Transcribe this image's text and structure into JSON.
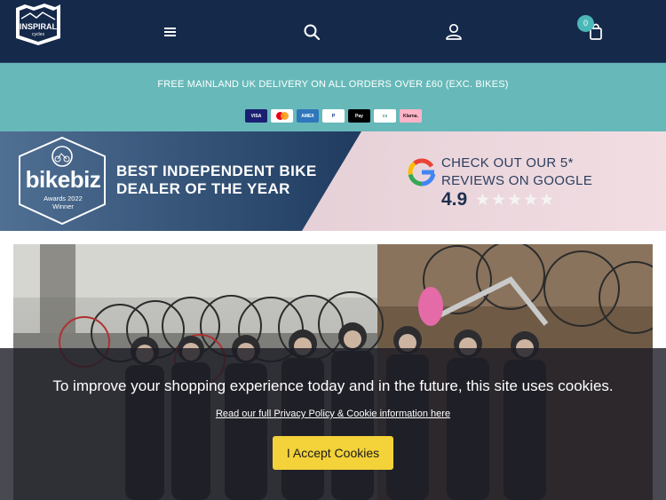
{
  "header": {
    "logo_text": "INSPIRAL cycles",
    "cart_count": "0",
    "icons": [
      "hamburger-menu-icon",
      "search-icon",
      "user-account-icon",
      "shopping-bag-icon"
    ],
    "background_color": "#15294a"
  },
  "delivery_banner": {
    "text": "FREE MAINLAND UK DELIVERY ON ALL ORDERS OVER £60 (EXC. BIKES)",
    "background_color": "#67b9b9",
    "payment_methods": [
      "VISA",
      "Mastercard",
      "American Express",
      "PayPal",
      "Apple Pay",
      "Cycle Scheme",
      "Klarna."
    ]
  },
  "awards_banner": {
    "bikebiz_name": "bikebiz",
    "bikebiz_sub_line1": "Awards 2022",
    "bikebiz_sub_line2": "Winner",
    "title_line1": "BEST INDEPENDENT BIKE",
    "title_line2": "DEALER OF THE YEAR",
    "google_line1": "CHECK OUT OUR 5*",
    "google_line2": "REVIEWS ON GOOGLE",
    "rating": "4.9",
    "stars_filled": 5
  },
  "cookie_banner": {
    "message": "To improve your shopping experience today and in the future, this site uses cookies.",
    "link_text": "Read our full Privacy Policy & Cookie information here",
    "accept_button": "I Accept Cookies",
    "button_color": "#f3d23a"
  }
}
